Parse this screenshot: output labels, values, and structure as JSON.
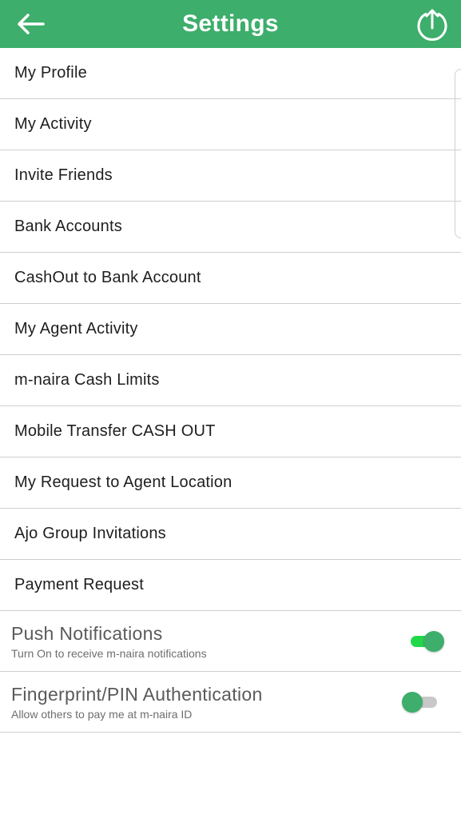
{
  "app_bar": {
    "title": "Settings",
    "back_icon": "arrow-left-icon",
    "action_icon": "upload-circle-icon",
    "color": "#3dae6b"
  },
  "menu": {
    "items": [
      {
        "label": "My Profile"
      },
      {
        "label": "My Activity"
      },
      {
        "label": "Invite Friends"
      },
      {
        "label": "Bank Accounts"
      },
      {
        "label": "CashOut to Bank Account"
      },
      {
        "label": "My Agent Activity"
      },
      {
        "label": "m-naira Cash Limits"
      },
      {
        "label": "Mobile Transfer CASH OUT"
      },
      {
        "label": "My Request to Agent Location"
      },
      {
        "label": "Ajo Group Invitations"
      },
      {
        "label": "Payment Request"
      }
    ]
  },
  "toggles": [
    {
      "title": "Push Notifications",
      "subtitle": "Turn On to receive m-naira notifications",
      "state": "on"
    },
    {
      "title": "Fingerprint/PIN Authentication",
      "subtitle": "Allow others to pay me at m-naira ID",
      "state": "off"
    }
  ]
}
